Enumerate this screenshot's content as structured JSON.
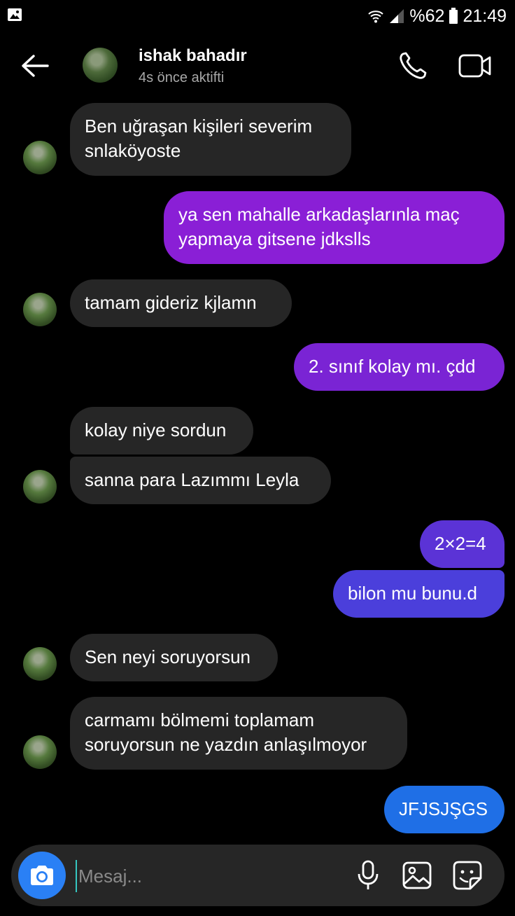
{
  "status_bar": {
    "battery": "%62",
    "time": "21:49"
  },
  "header": {
    "name": "ishak bahadır",
    "status": "4s önce aktifti"
  },
  "messages": [
    {
      "dir": "in",
      "lines": [
        "Ben uğraşan kişileri severim",
        "snlaköyoste"
      ]
    },
    {
      "dir": "out",
      "lines": [
        "ya sen mahalle arkadaşlarınla maç",
        "yapmaya gitsene jdkslls"
      ],
      "color": "#8a1fd6"
    },
    {
      "dir": "in",
      "lines": [
        "tamam gideriz kjlamn"
      ]
    },
    {
      "dir": "out",
      "lines": [
        "2. sınıf kolay mı. çdd"
      ],
      "color": "#7a24d4"
    },
    {
      "dir": "in",
      "lines": [
        "kolay niye sordun"
      ]
    },
    {
      "dir": "in",
      "lines": [
        "sanna para Lazımmı Leyla"
      ]
    },
    {
      "dir": "out",
      "lines": [
        "2×2=4"
      ],
      "color": "#5b33d6"
    },
    {
      "dir": "out",
      "lines": [
        "bilon mu bunu.d"
      ],
      "color": "#4b3fdb"
    },
    {
      "dir": "in",
      "lines": [
        "Sen neyi soruyorsun"
      ]
    },
    {
      "dir": "in",
      "lines": [
        "carmamı bölmemi toplamam",
        "soruyorsun ne yazdın anlaşılmoyor"
      ]
    },
    {
      "dir": "out",
      "lines": [
        "JFJSJŞGS"
      ],
      "color": "#1f6fe6"
    }
  ],
  "composer": {
    "placeholder": "Mesaj..."
  },
  "icons": {
    "back": "arrow-left-icon",
    "call": "phone-icon",
    "video": "video-camera-icon",
    "camera": "camera-icon",
    "mic": "microphone-icon",
    "gallery": "image-icon",
    "sticker": "sticker-icon"
  }
}
